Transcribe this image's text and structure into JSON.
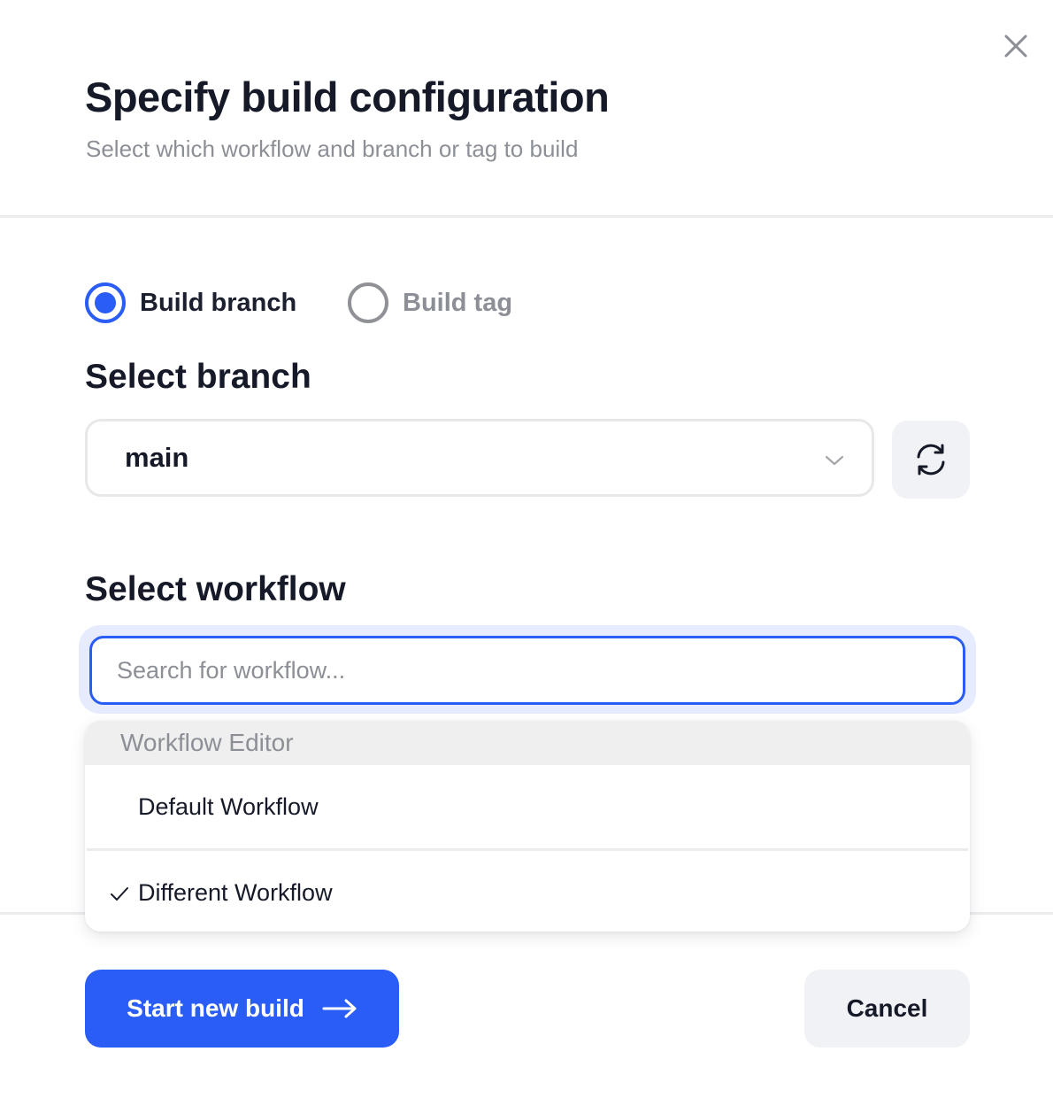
{
  "dialog": {
    "title": "Specify build configuration",
    "subtitle": "Select which workflow and branch or tag to build",
    "close_icon": "close-icon"
  },
  "build_type": {
    "options": [
      {
        "label": "Build branch",
        "checked": true
      },
      {
        "label": "Build tag",
        "checked": false
      }
    ]
  },
  "branch": {
    "label": "Select branch",
    "selected": "main",
    "dropdown_icon": "chevron-down-icon",
    "refresh_icon": "refresh-icon"
  },
  "workflow": {
    "label": "Select workflow",
    "search_placeholder": "Search for workflow...",
    "search_value": "",
    "group_label": "Workflow Editor",
    "options": [
      {
        "label": "Default Workflow",
        "selected": false
      },
      {
        "label": "Different Workflow",
        "selected": true
      }
    ]
  },
  "actions": {
    "primary_label": "Start new build",
    "primary_icon": "arrow-right-icon",
    "cancel_label": "Cancel"
  },
  "colors": {
    "accent": "#2a5cf6",
    "muted_text": "#8c8f96",
    "secondary_button_bg": "#f1f2f5",
    "focus_ring": "#e6ebfd"
  }
}
